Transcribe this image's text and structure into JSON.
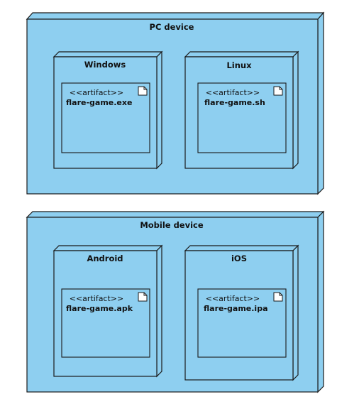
{
  "diagram": {
    "nodes": [
      {
        "title": "PC device",
        "children": [
          {
            "title": "Windows",
            "artifact": {
              "stereotype": "<<artifact>>",
              "name": "flare-game.exe",
              "icon": "document-icon"
            }
          },
          {
            "title": "Linux",
            "artifact": {
              "stereotype": "<<artifact>>",
              "name": "flare-game.sh",
              "icon": "document-icon"
            }
          }
        ]
      },
      {
        "title": "Mobile device",
        "children": [
          {
            "title": "Android",
            "artifact": {
              "stereotype": "<<artifact>>",
              "name": "flare-game.apk",
              "icon": "document-icon"
            }
          },
          {
            "title": "iOS",
            "artifact": {
              "stereotype": "<<artifact>>",
              "name": "flare-game.ipa",
              "icon": "document-icon"
            }
          }
        ]
      }
    ],
    "colors": {
      "node_fill": "#8ecff0",
      "stroke": "#1a1a1a"
    }
  }
}
